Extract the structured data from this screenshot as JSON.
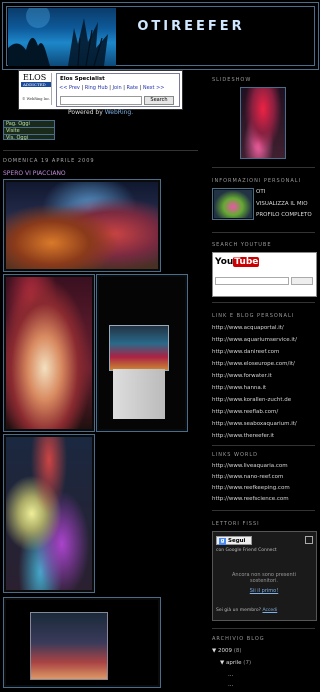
{
  "blog": {
    "title": "OTIREEFER"
  },
  "webring": {
    "logo_top": "ELOS",
    "logo_sub": "ADDICTED",
    "logo_footer": "© WebRing Inc.",
    "title": "Elos Specialist",
    "links": [
      "<< Prev",
      "Ring Hub",
      "Join",
      "Rate",
      "Next >>"
    ],
    "search_button": "Search"
  },
  "powered": {
    "prefix": "Powered by",
    "brand": "WebRing."
  },
  "counter": [
    "Pag. Oggi",
    "Visite",
    "Vis. Oggi"
  ],
  "post": {
    "date": "DOMENICA 19 APRILE 2009",
    "title": "SPERO VI PIACCIANO"
  },
  "sidebar": {
    "slideshow_title": "SLIDESHOW",
    "profile_title": "INFORMAZIONI PERSONALI",
    "profile_name": "OTI",
    "profile_link_1": "VISUALIZZA IL MIO",
    "profile_link_2": "PROFILO COMPLETO",
    "youtube_title": "SEARCH YOUTUBE",
    "youtube_logo_you": "You",
    "youtube_logo_tube": "Tube",
    "links_title": "LINK E BLOG PERSONALI",
    "links": [
      "http://www.acquaportal.it/",
      "http://www.aquariumservice.it/",
      "http://www.danireef.com",
      "http://www.eloseurope.com/it/",
      "http://www.forwater.it",
      "http://www.hanna.it",
      "http://www.korallen-zucht.de",
      "http://www.reeflab.com/",
      "http://www.seaboxaquarium.it/",
      "http://www.thereefer.it"
    ],
    "world_title": "LINKS WORLD",
    "world_links": [
      "http://www.liveaquaria.com",
      "http://www.nano-reef.com",
      "http://www.reefkeeping.com",
      "http://www.reefscience.com"
    ],
    "followers_title": "LETTORI FISSI",
    "gfc_follow": "Segui",
    "gfc_with": "con Google Friend Connect",
    "gfc_empty": "Ancora non sono presenti sostenitori.",
    "gfc_first": "Sii il primo!",
    "gfc_member": "Sei già un membro?",
    "gfc_login": "Accedi",
    "archive_title": "ARCHIVIO BLOG",
    "archive_year": "▼ 2009",
    "archive_year_count": "(8)",
    "archive_month": "▼ aprile",
    "archive_month_count": "(7)",
    "archive_dots_1": "...",
    "archive_dots_2": "..."
  },
  "colors": {
    "accent": "#4a6d8c",
    "link": "#d8d8d8",
    "post_title": "#c28adc",
    "header_title": "#cfe7ff"
  }
}
